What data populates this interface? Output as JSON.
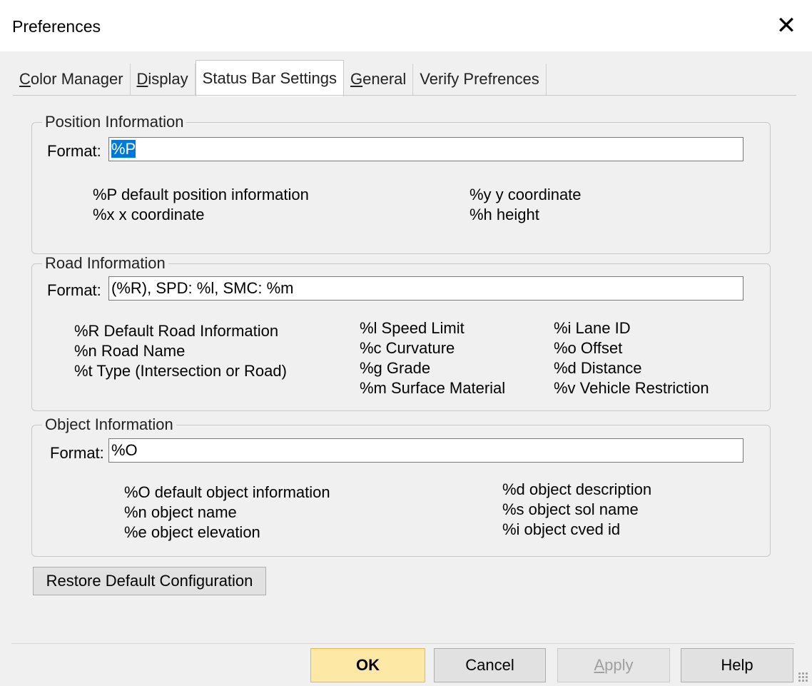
{
  "window": {
    "title": "Preferences",
    "close_glyph": "✕"
  },
  "tabs": [
    {
      "label": "Color Manager",
      "accel": "C",
      "rest": "olor Manager"
    },
    {
      "label": "Display",
      "accel": "D",
      "rest": "isplay"
    },
    {
      "label": "Status Bar Settings",
      "accel": "",
      "rest": "Status Bar Settings"
    },
    {
      "label": "General",
      "accel": "G",
      "rest": "eneral"
    },
    {
      "label": "Verify Prefrences",
      "accel": "",
      "rest": "Verify Prefrences"
    }
  ],
  "position_info": {
    "legend": "Position Information",
    "format_label": "Format:",
    "format_value": "%P",
    "help_col1": [
      "%P default position information",
      "%x x coordinate"
    ],
    "help_col2": [
      "%y y coordinate",
      "%h height"
    ]
  },
  "road_info": {
    "legend": "Road Information",
    "format_label": "Format:",
    "format_value": "(%R), SPD: %l, SMC: %m",
    "help_col1": [
      "%R Default Road Information",
      "%n Road Name",
      "%t Type (Intersection or Road)"
    ],
    "help_col2": [
      "%l Speed Limit",
      "%c Curvature",
      "%g Grade",
      "%m Surface Material"
    ],
    "help_col3": [
      "%i Lane ID",
      "%o Offset",
      "%d Distance",
      "%v Vehicle Restriction"
    ]
  },
  "object_info": {
    "legend": "Object Information",
    "format_label": "Format:",
    "format_value": "%O",
    "help_col1": [
      "%O default object information",
      "%n object name",
      "%e object elevation"
    ],
    "help_col2": [
      "%d object description",
      "%s object sol name",
      "%i object cved id"
    ]
  },
  "buttons": {
    "restore": "Restore Default Configuration",
    "ok": "OK",
    "cancel": "Cancel",
    "apply_accel": "A",
    "apply_rest": "pply",
    "help": "Help"
  }
}
